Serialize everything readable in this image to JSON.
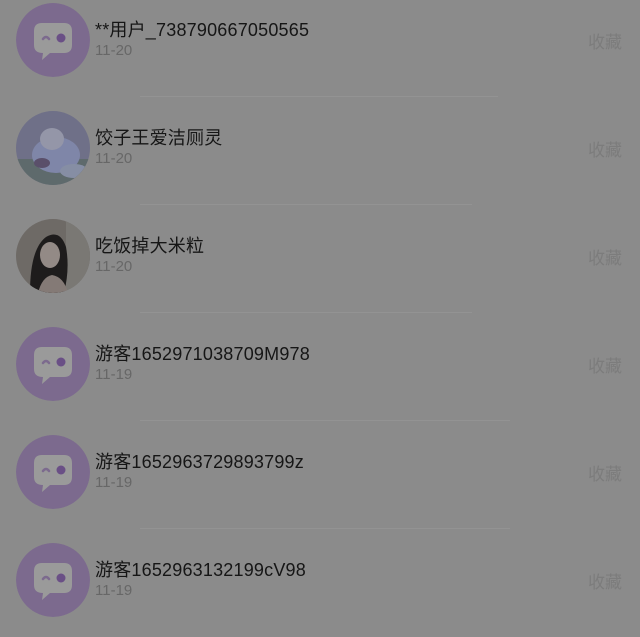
{
  "users": [
    {
      "name": "**用户_738790667050565",
      "date": "11-20",
      "action": "收藏",
      "avatar": "default-bubble-icon"
    },
    {
      "name": "饺子王爱洁厕灵",
      "date": "11-20",
      "action": "收藏",
      "avatar": "photo-cat-avatar"
    },
    {
      "name": "吃饭掉大米粒",
      "date": "11-20",
      "action": "收藏",
      "avatar": "photo-girl-avatar"
    },
    {
      "name": "游客1652971038709M978",
      "date": "11-19",
      "action": "收藏",
      "avatar": "default-bubble-icon"
    },
    {
      "name": "游客1652963729893799z",
      "date": "11-19",
      "action": "收藏",
      "avatar": "default-bubble-icon"
    },
    {
      "name": "游客1652963132199cV98",
      "date": "11-19",
      "action": "收藏",
      "avatar": "default-bubble-icon"
    }
  ],
  "colors": {
    "overlay_bg": "#8b8b8b",
    "default_avatar_bg": "#7c6a8e",
    "name_text": "#161616",
    "date_text": "#676767",
    "action_text": "#7c7c7c"
  }
}
